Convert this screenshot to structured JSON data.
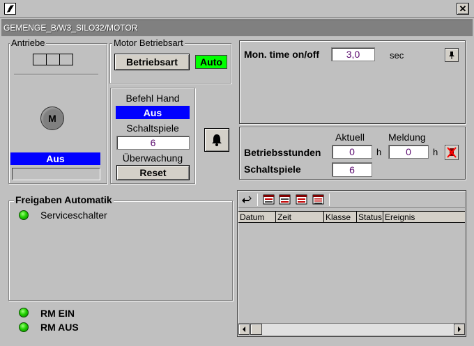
{
  "window": {
    "path": "GEMENGE_B/W3_SILO32/MOTOR",
    "close_glyph": "✕"
  },
  "antriebe": {
    "title": "Antriebe",
    "motor_symbol": "M",
    "status": "Aus",
    "status_color": "#0000ff"
  },
  "motor_betriebsart": {
    "title": "Motor Betriebsart",
    "button_label": "Betriebsart",
    "mode": "Auto",
    "mode_color": "#00ff00"
  },
  "befehl_hand": {
    "label": "Befehl Hand",
    "value": "Aus",
    "schaltspiele_label": "Schaltspiele",
    "schaltspiele_value": "6",
    "ueberwachung_label": "Überwachung",
    "reset_label": "Reset"
  },
  "mon_time": {
    "label": "Mon. time on/off",
    "value": "3,0",
    "unit": "sec"
  },
  "counters": {
    "col_aktuell": "Aktuell",
    "col_meldung": "Meldung",
    "betriebsstunden_label": "Betriebsstunden",
    "betriebsstunden_aktuell": "0",
    "betriebsstunden_meldung": "0",
    "unit_h": "h",
    "schaltspiele_label": "Schaltspiele",
    "schaltspiele_aktuell": "6"
  },
  "freigaben": {
    "title": "Freigaben Automatik",
    "items": [
      "Serviceschalter"
    ]
  },
  "rm": {
    "ein": "RM EIN",
    "aus": "RM AUS"
  },
  "alarm_table": {
    "columns": [
      "Datum",
      "Zeit",
      "Klasse",
      "Status",
      "Ereignis"
    ]
  },
  "colors": {
    "background": "#c0c0c0",
    "led_green": "#20d000",
    "value_text": "#5a0a6e"
  }
}
